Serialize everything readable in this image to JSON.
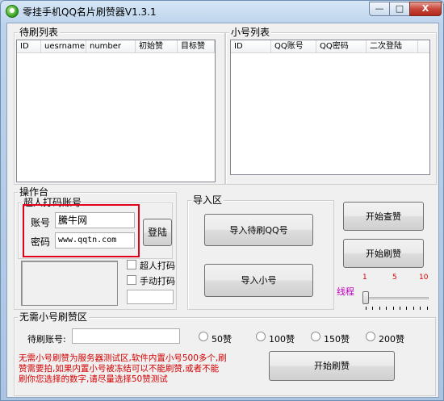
{
  "window": {
    "title": "零挂手机QQ名片刷赞器V1.3.1"
  },
  "title_controls": {
    "minimize": "—",
    "maximize": "□",
    "close": "X"
  },
  "pending_list": {
    "title": "待刷列表",
    "columns": [
      "ID",
      "uesrname",
      "number",
      "初始赞",
      "目标赞"
    ]
  },
  "alt_list": {
    "title": "小号列表",
    "columns": [
      "ID",
      "QQ账号",
      "QQ密码",
      "二次登陆"
    ]
  },
  "console": {
    "title": "操作台",
    "captcha_account": {
      "title": "超人打码账号",
      "account_label": "账号",
      "account_value": "騰牛网",
      "password_label": "密码",
      "password_value": "www.qqtn.com",
      "login_button": "登陆"
    },
    "checkboxes": [
      {
        "label": "超人打码",
        "checked": false
      },
      {
        "label": "手动打码",
        "checked": false
      }
    ],
    "captcha_input": ""
  },
  "import": {
    "title": "导入区",
    "import_qq_button": "导入待刷QQ号",
    "import_alt_button": "导入小号"
  },
  "actions": {
    "check_button": "开始查赞",
    "start_button": "开始刷赞"
  },
  "threads": {
    "label": "线程",
    "ticks": [
      "1",
      "5",
      "10"
    ],
    "value": 1
  },
  "no_alt": {
    "title": "无需小号刷赞区",
    "account_label": "待刷账号:",
    "account_value": "",
    "options": [
      "50赞",
      "100赞",
      "150赞",
      "200赞"
    ],
    "notice_lines": [
      "无需小号刷赞为服务器测试区,软件内置小号500多个,刷",
      "赞需要拍,如果内置小号被冻结可以不能刷赞,或者不能",
      "刷你您选择的数字,请尽量选择50赞测试"
    ],
    "start_button": "开始刷赞"
  },
  "colors": {
    "highlight_frame": "#e0001a",
    "notice_text": "#d40000",
    "threads_label": "#c000c0",
    "tick_labels": "#d40000"
  }
}
